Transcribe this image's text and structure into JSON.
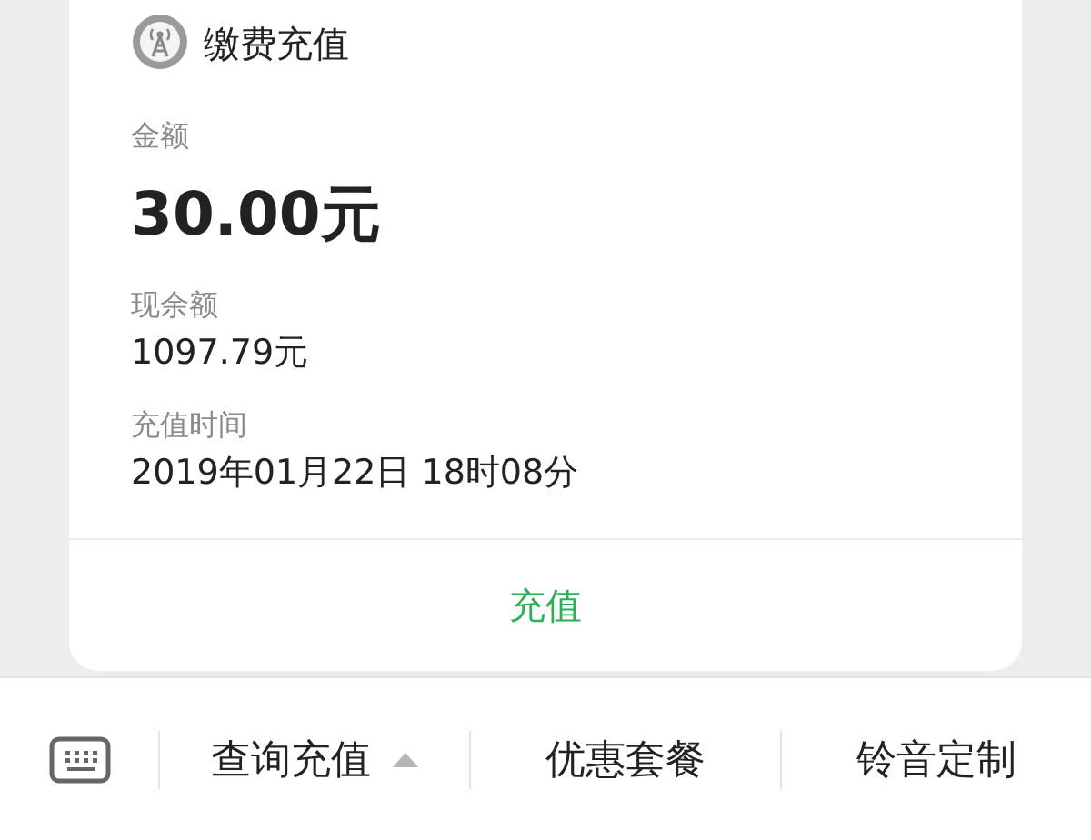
{
  "card": {
    "title": "缴费充值",
    "fields": [
      {
        "label": "金额",
        "value": "30.00元",
        "kind": "large"
      },
      {
        "label": "现余额",
        "value": "1097.79元",
        "kind": "normal"
      },
      {
        "label": "充值时间",
        "value": "2019年01月22日 18时08分",
        "kind": "normal"
      }
    ],
    "action": "充值"
  },
  "menu": [
    {
      "label": "查询充值",
      "has_submenu": true
    },
    {
      "label": "优惠套餐",
      "has_submenu": false
    },
    {
      "label": "铃音定制",
      "has_submenu": false
    }
  ]
}
